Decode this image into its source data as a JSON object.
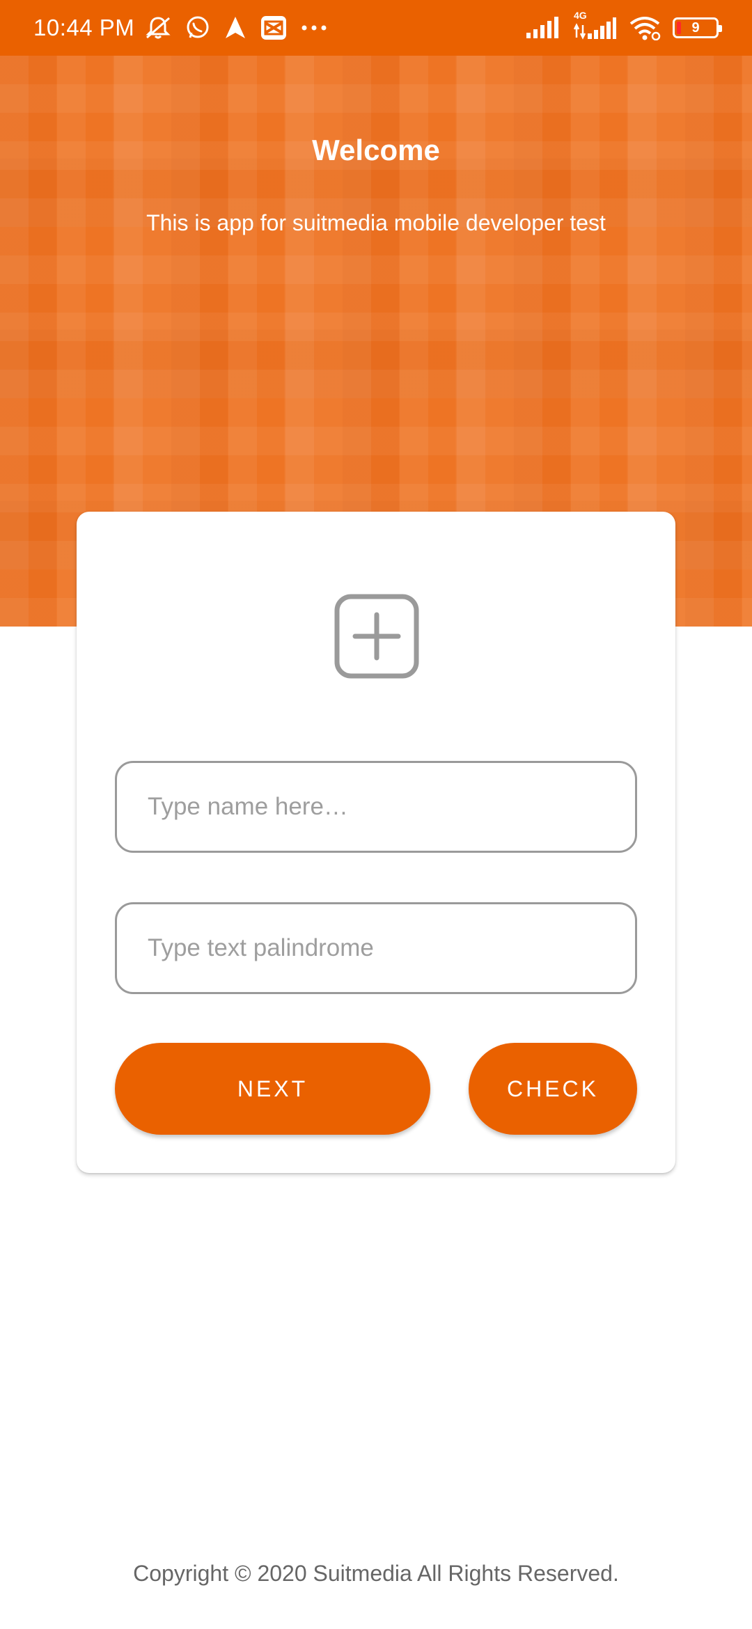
{
  "status_bar": {
    "time": "10:44 PM",
    "battery_level": "9",
    "network_type": "4G",
    "icons_left": [
      "muted-notification-icon",
      "whatsapp-icon",
      "navigation-arrow-icon",
      "capcut-icon",
      "more-dots-icon"
    ],
    "icons_right": [
      "signal-icon",
      "signal-4g-icon",
      "wifi-icon",
      "battery-icon"
    ]
  },
  "header": {
    "title": "Welcome",
    "subtitle": "This is app for suitmedia mobile developer test"
  },
  "card": {
    "add_photo_icon": "add-square-icon",
    "name_input": {
      "placeholder": "Type name here…",
      "value": ""
    },
    "palindrome_input": {
      "placeholder": "Type text palindrome",
      "value": ""
    },
    "next_label": "NEXT",
    "check_label": "CHECK"
  },
  "footer": {
    "copyright": "Copyright © 2020 Suitmedia All Rights Reserved."
  },
  "colors": {
    "accent": "#ea6100",
    "banner": "#ee7424",
    "input_border": "#9a9a9a",
    "placeholder": "#9e9e9e",
    "footer_text": "#666666"
  }
}
